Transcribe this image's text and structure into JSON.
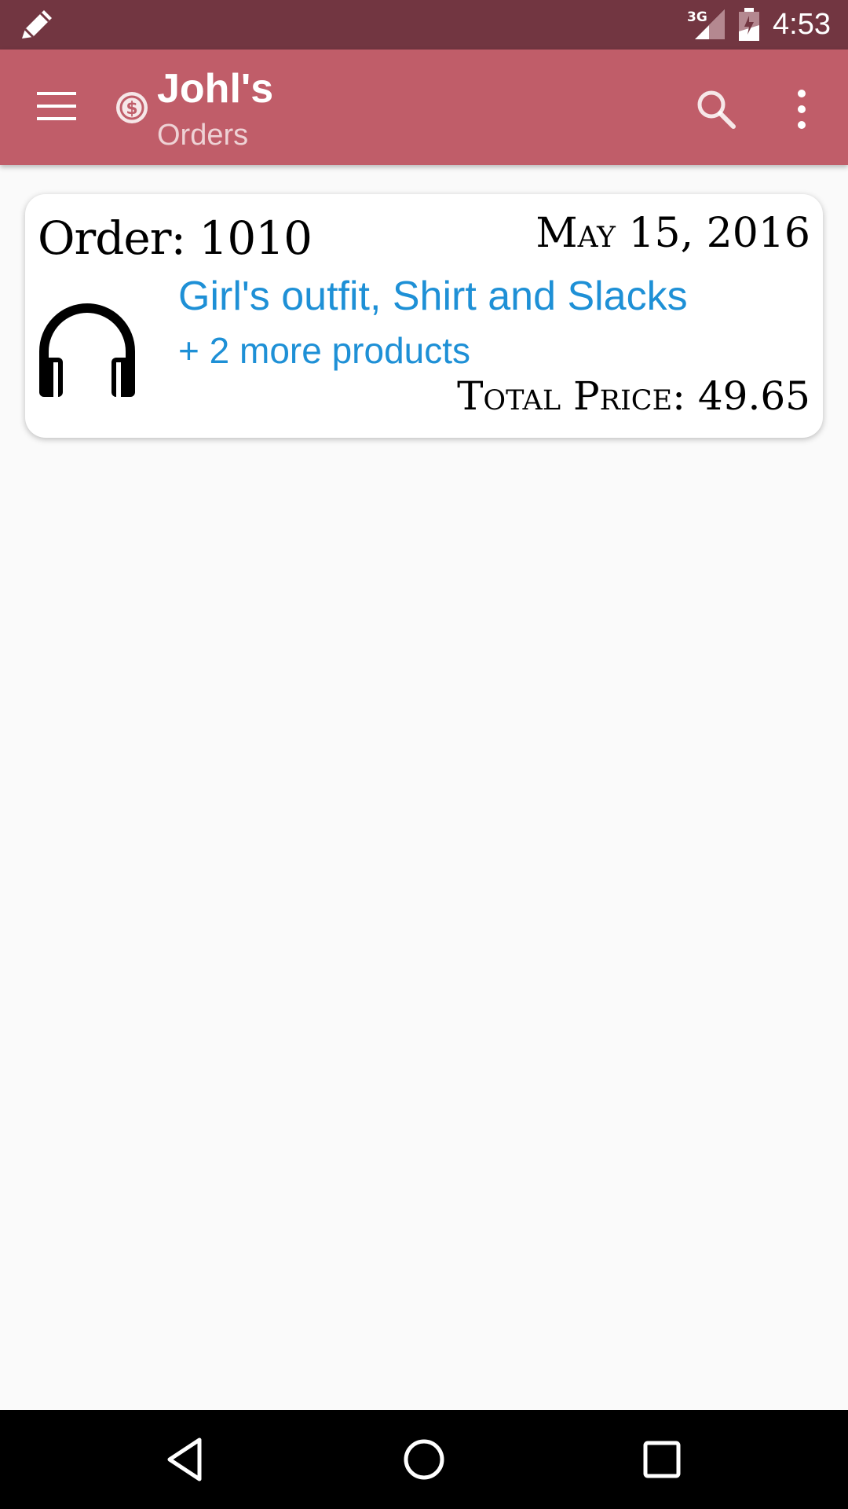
{
  "status_bar": {
    "network": "3G",
    "time": "4:53",
    "icons": [
      "edit-icon",
      "signal-icon",
      "battery-icon"
    ]
  },
  "app_bar": {
    "title": "Johl's",
    "subtitle": "Orders",
    "icons": [
      "menu-icon",
      "dollar-coin-icon",
      "search-icon",
      "overflow-menu-icon"
    ]
  },
  "orders": [
    {
      "order_label": "Order: 1010",
      "date": "May 15, 2016",
      "product_name": "Girl's outfit, Shirt and Slacks",
      "more_products": "+ 2 more products",
      "total_price": "Total Price: 49.65",
      "icon": "headphones-icon"
    }
  ],
  "nav_bar": {
    "icons": [
      "back-icon",
      "home-icon",
      "recents-icon"
    ]
  },
  "colors": {
    "status_bar": "#723641",
    "app_bar": "#c05d69",
    "link_blue": "#1e90d6",
    "background": "#fafafa"
  }
}
